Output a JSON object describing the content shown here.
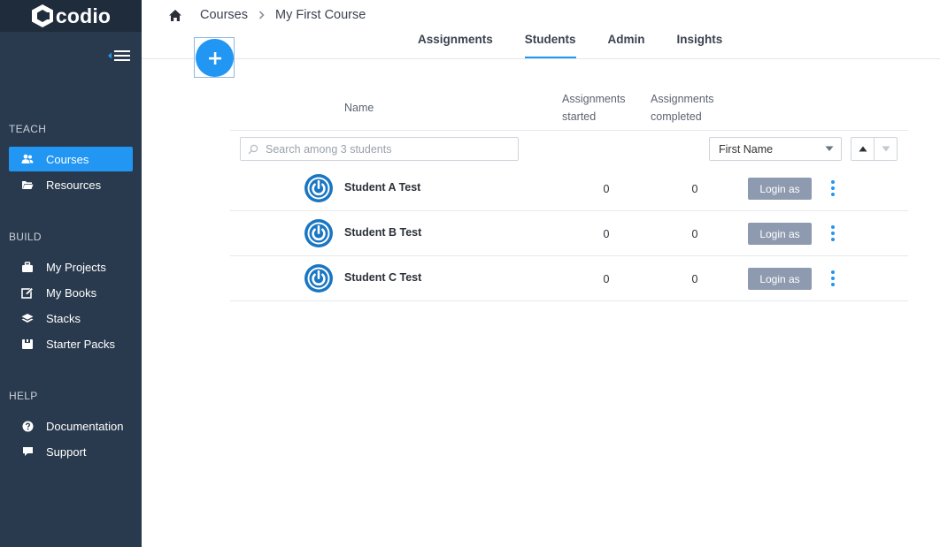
{
  "app": {
    "logo_text": "codio"
  },
  "sidebar": {
    "sections": [
      {
        "label": "TEACH",
        "items": [
          {
            "label": "Courses",
            "icon": "users-icon",
            "active": true
          },
          {
            "label": "Resources",
            "icon": "folder-icon",
            "active": false
          }
        ]
      },
      {
        "label": "BUILD",
        "items": [
          {
            "label": "My Projects",
            "icon": "briefcase-icon",
            "active": false
          },
          {
            "label": "My Books",
            "icon": "edit-icon",
            "active": false
          },
          {
            "label": "Stacks",
            "icon": "layers-icon",
            "active": false
          },
          {
            "label": "Starter Packs",
            "icon": "package-icon",
            "active": false
          }
        ]
      },
      {
        "label": "HELP",
        "items": [
          {
            "label": "Documentation",
            "icon": "question-icon",
            "active": false
          },
          {
            "label": "Support",
            "icon": "chat-icon",
            "active": false
          }
        ]
      }
    ]
  },
  "breadcrumb": {
    "items": [
      "Courses",
      "My First Course"
    ]
  },
  "tabs": [
    {
      "label": "Assignments",
      "active": false
    },
    {
      "label": "Students",
      "active": true
    },
    {
      "label": "Admin",
      "active": false
    },
    {
      "label": "Insights",
      "active": false
    }
  ],
  "table": {
    "headers": {
      "name": "Name",
      "started_line1": "Assignments",
      "started_line2": "started",
      "completed_line1": "Assignments",
      "completed_line2": "completed"
    },
    "search_placeholder": "Search among 3 students",
    "sort_field": "First Name",
    "login_label": "Login as",
    "rows": [
      {
        "name": "Student A Test",
        "started": "0",
        "completed": "0"
      },
      {
        "name": "Student B Test",
        "started": "0",
        "completed": "0"
      },
      {
        "name": "Student C Test",
        "started": "0",
        "completed": "0"
      }
    ]
  },
  "colors": {
    "accent": "#2196f3",
    "sidebar_bg": "#2a3a4e",
    "logo_bar_bg": "#1f2c3b",
    "login_button": "#8e9aaf"
  }
}
